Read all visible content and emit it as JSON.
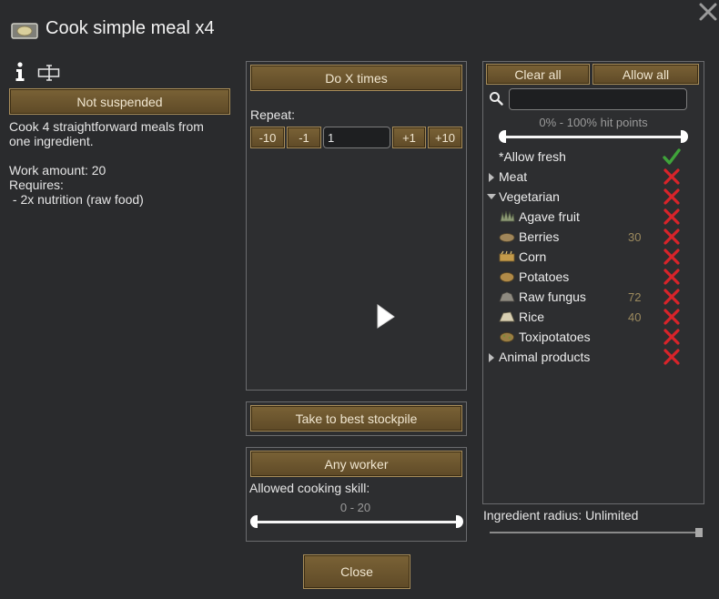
{
  "window": {
    "title": "Cook simple meal x4"
  },
  "left": {
    "suspend_label": "Not suspended",
    "description_lines": [
      "Cook 4 straightforward meals from",
      "one ingredient."
    ],
    "work_amount": "Work amount: 20",
    "requires_label": "Requires:",
    "requires_items": [
      " - 2x nutrition (raw food)"
    ]
  },
  "middle": {
    "mode_label": "Do X times",
    "repeat_label": "Repeat:",
    "buttons": {
      "minus10": "-10",
      "minus1": "-1",
      "plus1": "+1",
      "plus10": "+10"
    },
    "repeat_value": "1",
    "store_label": "Take to best stockpile",
    "worker_label": "Any worker",
    "skill_label": "Allowed cooking skill:",
    "skill_range": "0 - 20"
  },
  "filter": {
    "clear_all": "Clear all",
    "allow_all": "Allow all",
    "search_value": "",
    "hp_range": "0% - 100% hit points",
    "items": [
      {
        "label": "*Allow fresh",
        "allowed": true,
        "depth": 0,
        "expander": "none",
        "count": ""
      },
      {
        "label": "Meat",
        "allowed": false,
        "depth": 0,
        "expander": "collapsed",
        "count": ""
      },
      {
        "label": "Vegetarian",
        "allowed": false,
        "depth": 0,
        "expander": "expanded",
        "count": ""
      },
      {
        "label": "Agave fruit",
        "allowed": false,
        "depth": 1,
        "icon": "agave-icon",
        "count": ""
      },
      {
        "label": "Berries",
        "allowed": false,
        "depth": 1,
        "icon": "berries-icon",
        "count": "30"
      },
      {
        "label": "Corn",
        "allowed": false,
        "depth": 1,
        "icon": "corn-icon",
        "count": ""
      },
      {
        "label": "Potatoes",
        "allowed": false,
        "depth": 1,
        "icon": "potatoes-icon",
        "count": ""
      },
      {
        "label": "Raw fungus",
        "allowed": false,
        "depth": 1,
        "icon": "fungus-icon",
        "count": "72"
      },
      {
        "label": "Rice",
        "allowed": false,
        "depth": 1,
        "icon": "rice-icon",
        "count": "40"
      },
      {
        "label": "Toxipotatoes",
        "allowed": false,
        "depth": 1,
        "icon": "toxipotatoes-icon",
        "count": ""
      },
      {
        "label": "Animal products",
        "allowed": false,
        "depth": 0,
        "expander": "collapsed",
        "count": ""
      }
    ],
    "radius_label": "Ingredient radius: Unlimited",
    "radius_level": 1.0
  },
  "footer": {
    "close_label": "Close"
  },
  "colors": {
    "accent_brown": "#6e5630",
    "check_green": "#3fa33a",
    "cross_red": "#d8242a"
  }
}
